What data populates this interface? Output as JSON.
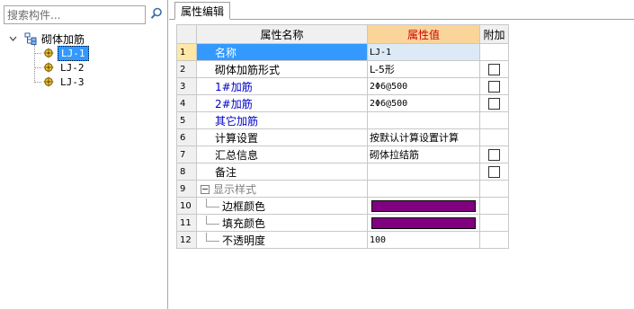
{
  "search": {
    "placeholder": "搜索构件..."
  },
  "tree": {
    "root_label": "砌体加筋",
    "children": [
      {
        "label": "LJ-1",
        "selected": true
      },
      {
        "label": "LJ-2",
        "selected": false
      },
      {
        "label": "LJ-3",
        "selected": false
      }
    ]
  },
  "tab": {
    "label": "属性编辑"
  },
  "grid": {
    "headers": {
      "name": "属性名称",
      "value": "属性值",
      "addon": "附加"
    },
    "rows": [
      {
        "num": "1",
        "name": "名称",
        "value": "LJ-1",
        "addon": false
      },
      {
        "num": "2",
        "name": "砌体加筋形式",
        "value": "L-5形",
        "addon": true
      },
      {
        "num": "3",
        "name": "1#加筋",
        "value": "2Φ6@500",
        "addon": true
      },
      {
        "num": "4",
        "name": "2#加筋",
        "value": "2Φ6@500",
        "addon": true
      },
      {
        "num": "5",
        "name": "其它加筋",
        "value": "",
        "addon": false
      },
      {
        "num": "6",
        "name": "计算设置",
        "value": "按默认计算设置计算",
        "addon": false
      },
      {
        "num": "7",
        "name": "汇总信息",
        "value": "砌体拉结筋",
        "addon": true
      },
      {
        "num": "8",
        "name": "备注",
        "value": "",
        "addon": true
      },
      {
        "num": "9",
        "name": "显示样式",
        "value": "",
        "addon": false
      },
      {
        "num": "10",
        "name": "边框颜色",
        "value": "",
        "addon": false
      },
      {
        "num": "11",
        "name": "填充颜色",
        "value": "",
        "addon": false
      },
      {
        "num": "12",
        "name": "不透明度",
        "value": "100",
        "addon": false
      }
    ]
  },
  "colors": {
    "border_color": "#800080",
    "fill_color": "#800080",
    "selection": "#3399ff",
    "value_header_bg": "#fad599"
  }
}
